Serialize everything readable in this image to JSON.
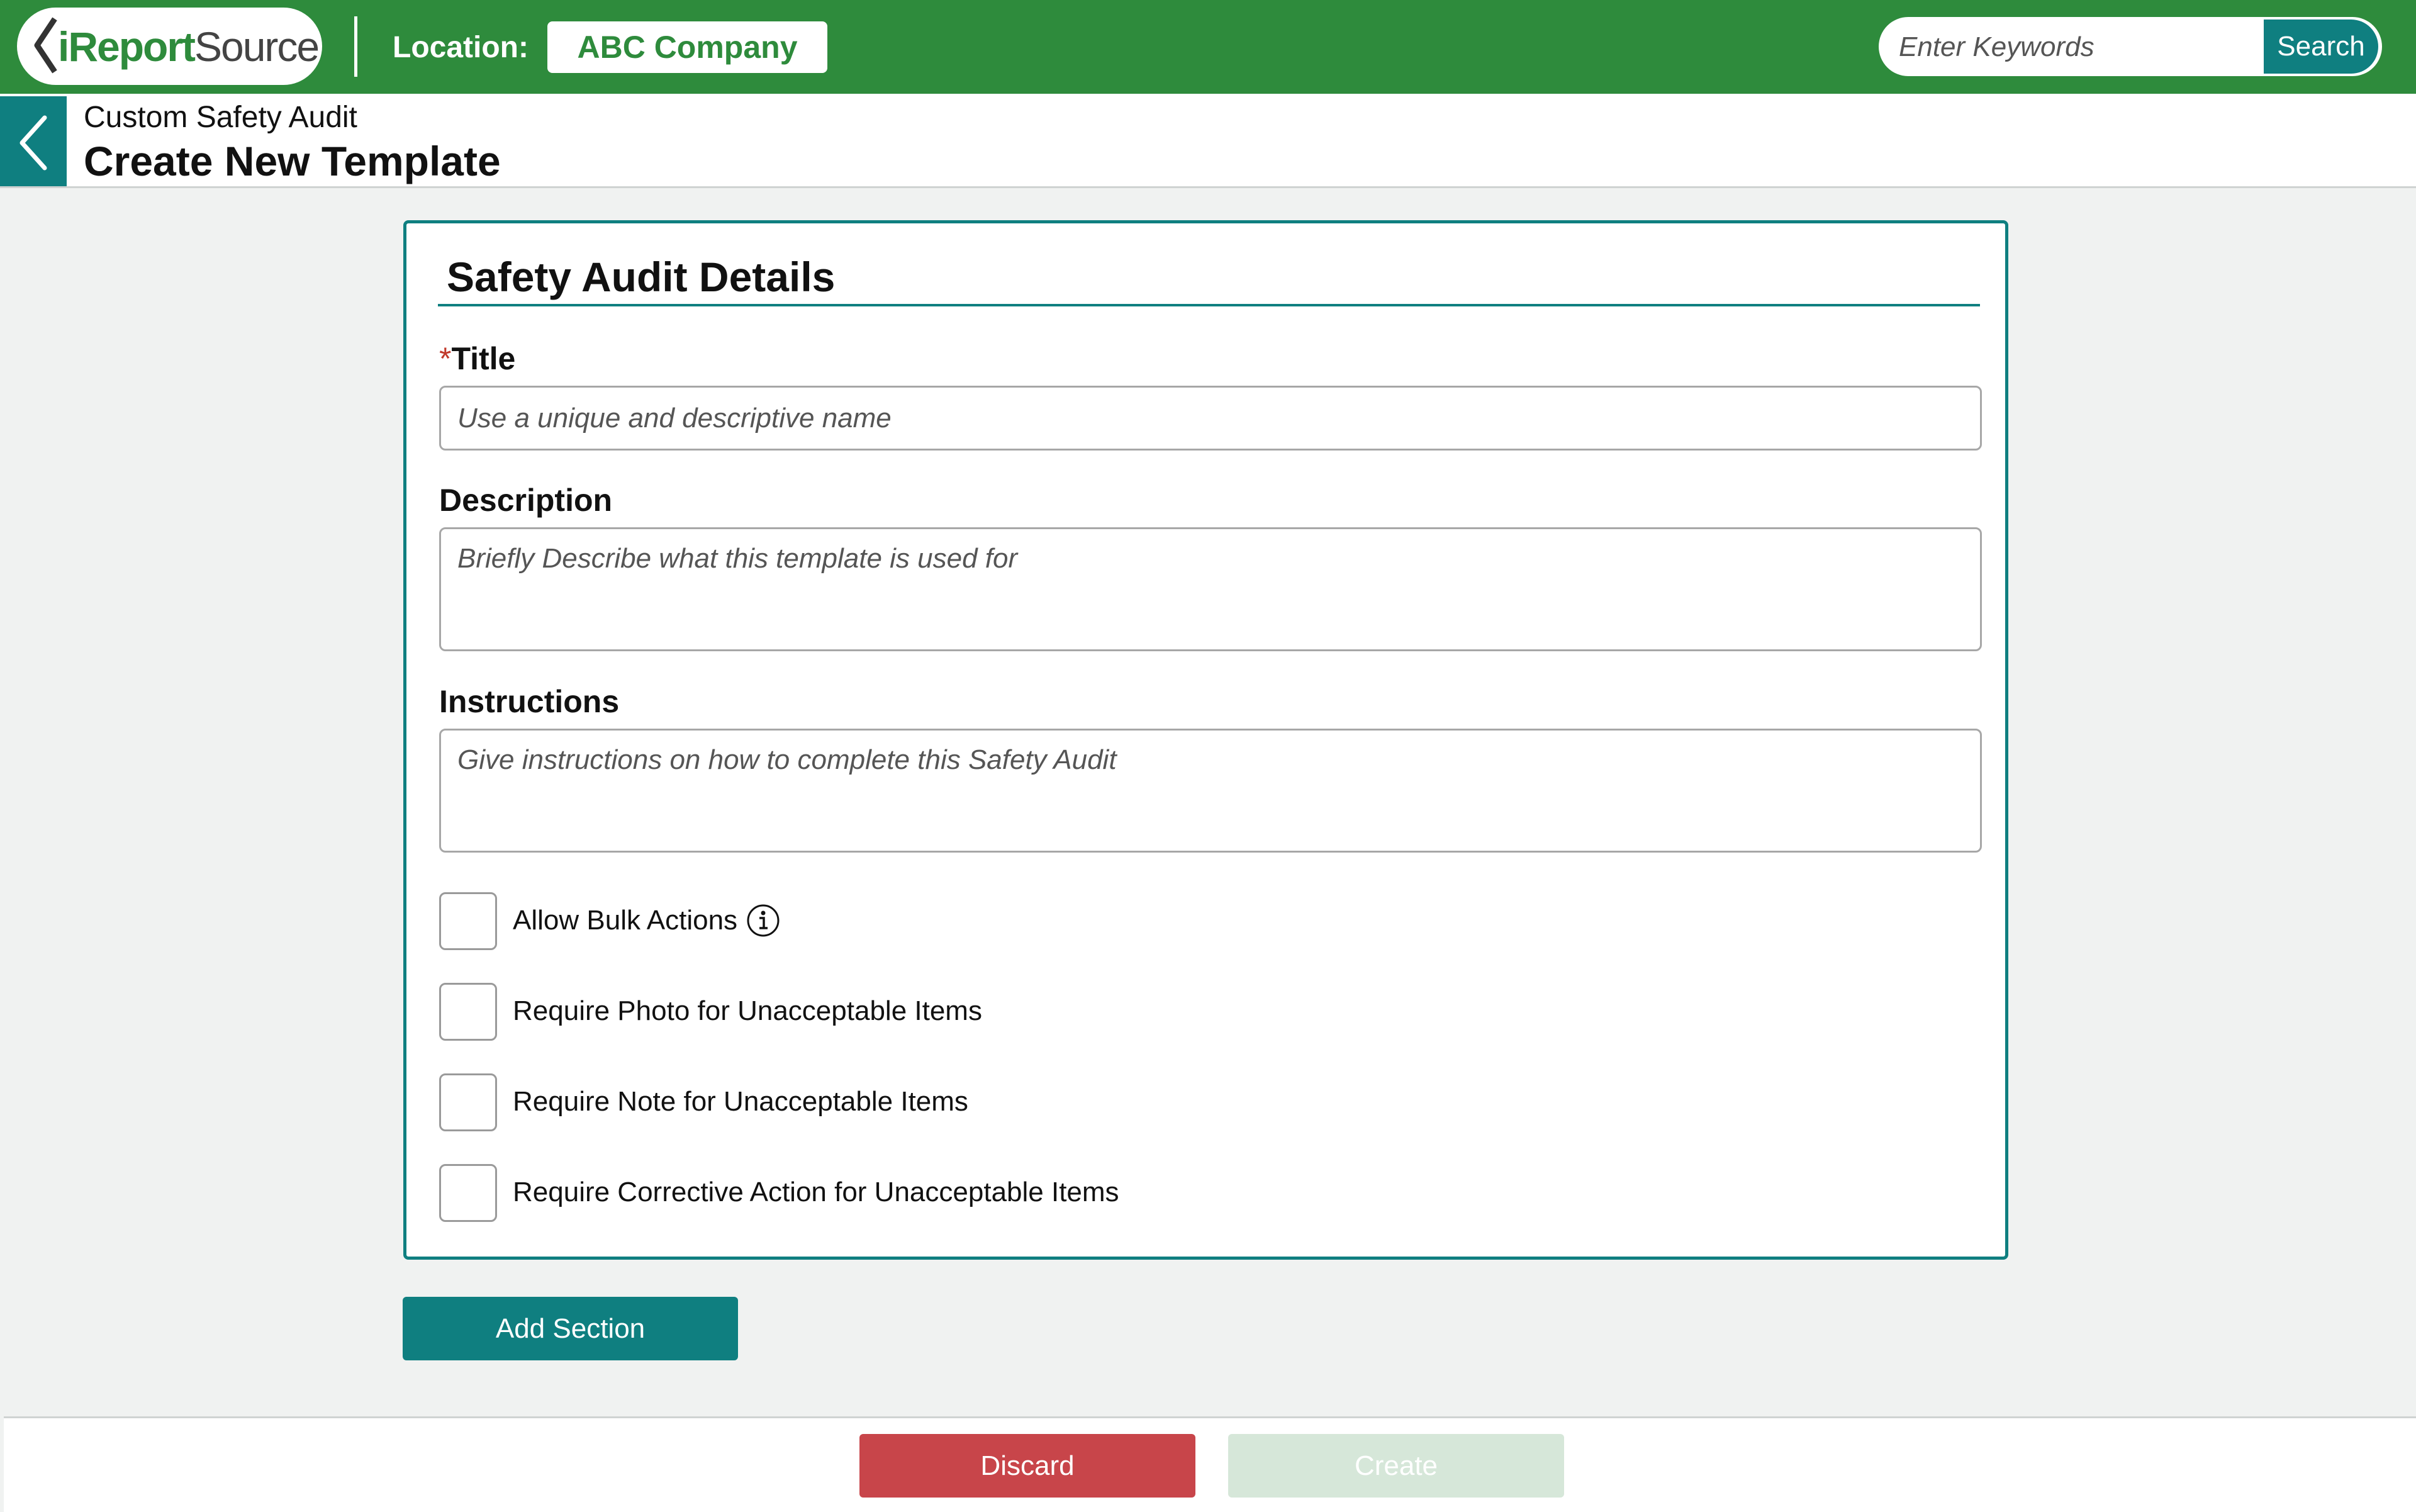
{
  "header": {
    "logo": {
      "part1": "iReport",
      "part2": "Source"
    },
    "location_label": "Location:",
    "location_value": "ABC Company",
    "search": {
      "placeholder": "Enter Keywords",
      "button_label": "Search"
    }
  },
  "subheader": {
    "module": "Custom Safety Audit",
    "page_title": "Create New Template"
  },
  "card": {
    "title": "Safety Audit Details",
    "required_mark": "*",
    "fields": {
      "title": {
        "label": "Title",
        "value": "",
        "placeholder": "Use a unique and descriptive name"
      },
      "description": {
        "label": "Description",
        "value": "",
        "placeholder": "Briefly Describe what this template is used for"
      },
      "instructions": {
        "label": "Instructions",
        "value": "",
        "placeholder": "Give instructions on how to complete this Safety Audit"
      }
    },
    "checkboxes": [
      {
        "label": "Allow Bulk Actions",
        "checked": false
      },
      {
        "label": "Require Photo for Unacceptable Items",
        "checked": false
      },
      {
        "label": "Require Note for Unacceptable Items",
        "checked": false
      },
      {
        "label": "Require Corrective Action for Unacceptable Items",
        "checked": false
      }
    ]
  },
  "actions": {
    "add_section": "Add Section",
    "discard": "Discard",
    "create": "Create"
  },
  "colors": {
    "header_green": "#2e8b3c",
    "teal": "#0f7f80",
    "discard_red": "#c8454a",
    "create_disabled": "#d6e7d9"
  }
}
